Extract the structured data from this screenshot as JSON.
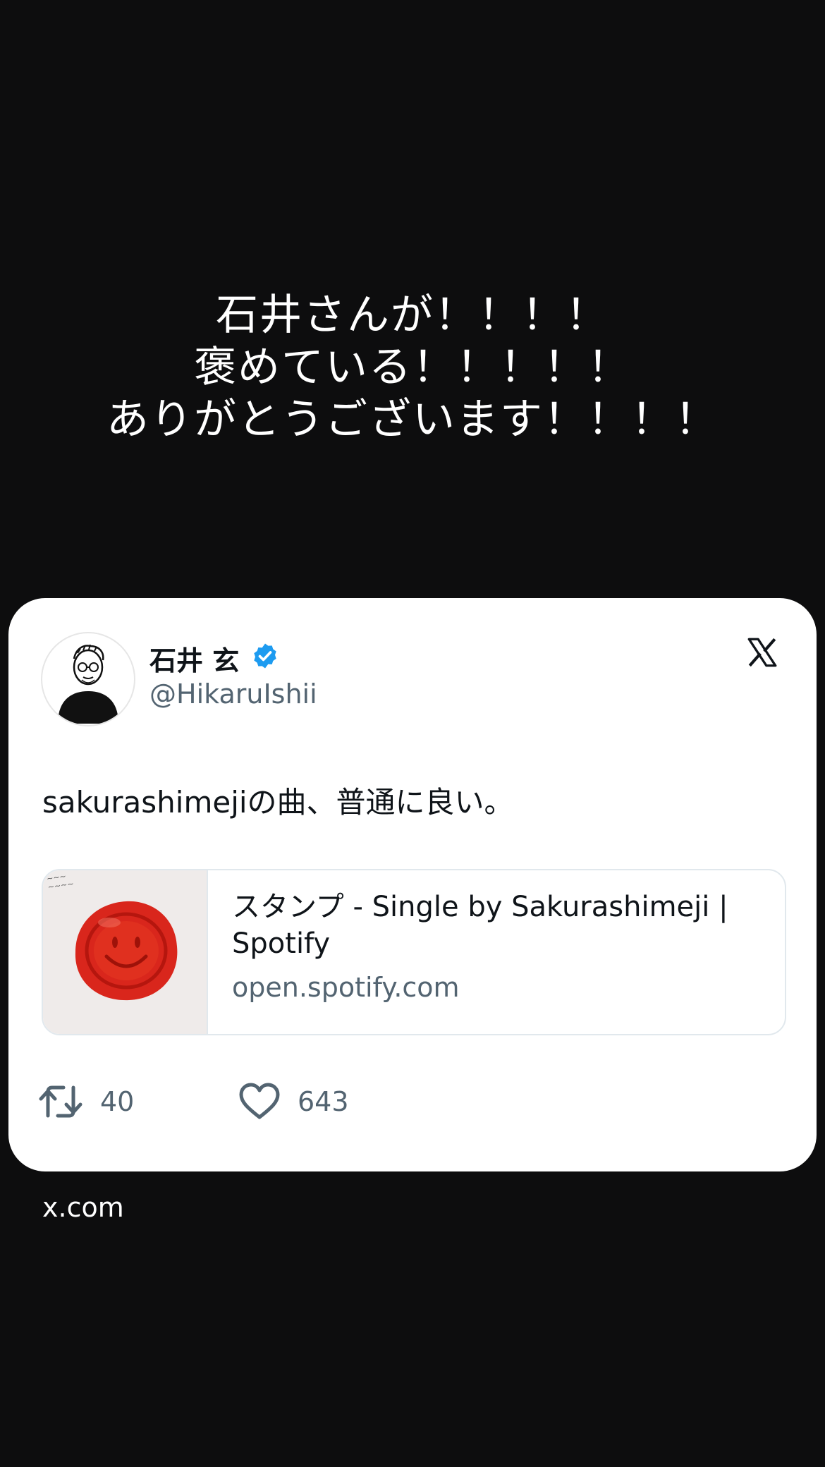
{
  "caption": {
    "lines": [
      "石井さんが！！！！",
      "褒めている！！！！！",
      "ありがとうございます！！！！"
    ]
  },
  "tweet": {
    "author": {
      "display_name": "石井 玄",
      "handle": "@HikaruIshii",
      "verified": true
    },
    "platform_icon": "x-logo-icon",
    "text": "sakurashimejiの曲、普通に良い。",
    "link_card": {
      "title": "スタンプ - Single by Sakurashimeji | Spotify",
      "domain": "open.spotify.com",
      "thumbnail_icon": "red-wax-seal-smiley"
    },
    "actions": {
      "retweets": "40",
      "likes": "643"
    }
  },
  "footer": {
    "domain": "x.com"
  },
  "colors": {
    "background": "#0d0d0e",
    "card": "#ffffff",
    "verified_badge": "#1d9bf0",
    "secondary_text": "#536471",
    "seal_red": "#d9261c"
  }
}
